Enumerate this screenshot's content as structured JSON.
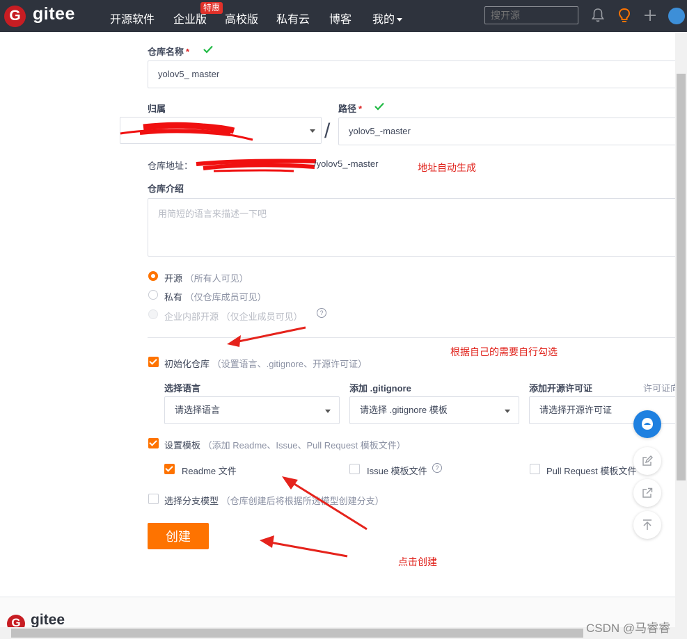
{
  "nav": {
    "logo_letter": "G",
    "logo_text": "gitee",
    "items": [
      "开源软件",
      "企业版",
      "高校版",
      "私有云",
      "博客",
      "我的"
    ],
    "enterprise_badge": "特惠",
    "search_placeholder": "搜开源"
  },
  "form": {
    "repo_name_label": "仓库名称",
    "required_mark": "*",
    "repo_name_value": "yolov5_ master",
    "owner_label": "归属",
    "path_label": "路径",
    "path_value": "yolov5_-master",
    "slash": "/",
    "address_label": "仓库地址：",
    "address_suffix": "/yolov5_-master",
    "intro_label": "仓库介绍",
    "intro_placeholder": "用简短的语言来描述一下吧",
    "visibility": [
      {
        "label": "开源",
        "hint": "（所有人可见）",
        "state": "selected"
      },
      {
        "label": "私有",
        "hint": "（仅仓库成员可见）",
        "state": "unselected"
      },
      {
        "label": "企业内部开源",
        "hint": "（仅企业成员可见）",
        "state": "disabled"
      }
    ],
    "help_glyph": "?",
    "init_repo_label": "初始化仓库",
    "init_repo_hint": "（设置语言、.gitignore、开源许可证）",
    "language_label": "选择语言",
    "language_placeholder": "请选择语言",
    "gitignore_label": "添加 .gitignore",
    "gitignore_placeholder": "请选择 .gitignore 模板",
    "license_label": "添加开源许可证",
    "license_placeholder": "请选择开源许可证",
    "license_extra": "许可证向",
    "template_label": "设置模板",
    "template_hint": "（添加 Readme、Issue、Pull Request 模板文件）",
    "readme_label": "Readme 文件",
    "issue_label": "Issue 模板文件",
    "pr_label": "Pull Request 模板文件",
    "branch_model_label": "选择分支模型",
    "branch_model_hint": "（仓库创建后将根据所选模型创建分支）",
    "create_button": "创建"
  },
  "annotations": {
    "auto_address": "地址自动生成",
    "choose_needs": "根据自己的需要自行勾选",
    "click_create": "点击创建"
  },
  "footer": {
    "logo_letter": "G",
    "logo_text": "gitee"
  },
  "watermark": "CSDN @马睿睿",
  "colors": {
    "nav_bg": "#2e333d",
    "accent": "#fe7300",
    "valid_check": "#21ba45",
    "annotation_red": "#e0231c",
    "required_red": "#db2828"
  },
  "icons": [
    "bell-icon",
    "lightbulb-icon",
    "plus-icon",
    "avatar",
    "check-icon",
    "caret-down-icon",
    "help-icon",
    "chat-icon",
    "edit-icon",
    "share-icon",
    "back-to-top-icon"
  ]
}
